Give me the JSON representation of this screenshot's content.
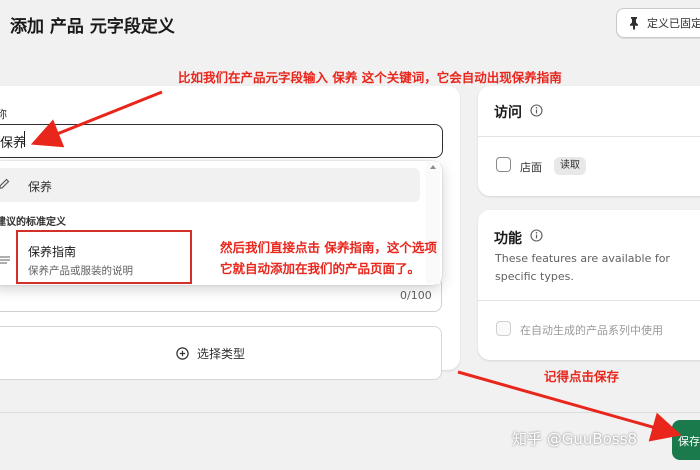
{
  "header": {
    "title": "添加 产品 元字段定义",
    "pin_button_label": "定义已固定"
  },
  "form": {
    "name_label": "称",
    "name_value": "保养",
    "dropdown": {
      "keyword_option": "保养",
      "section_title": "建议的标准定义",
      "suggested_title": "保养指南",
      "suggested_desc": "保养产品或服装的说明"
    },
    "char_counter": "0/100",
    "select_type_label": "选择类型"
  },
  "access": {
    "title": "访问",
    "store_label": "店面",
    "read_badge": "读取"
  },
  "functions": {
    "title": "功能",
    "description": "These features are available for specific types.",
    "auto_collections_label": "在自动生成的产品系列中使用"
  },
  "footer": {
    "save_label": "保存"
  },
  "annotations": {
    "note1": "比如我们在产品元字段输入 保养 这个关键词，它会自动出现保养指南",
    "note2_line1": "然后我们直接点击 保养指南，这个选项",
    "note2_line2": "它就自动添加在我们的产品页面了。",
    "note3": "记得点击保存"
  },
  "watermark": "知乎 @GuuBoss8",
  "colors": {
    "annotation_red": "#e8261c",
    "save_green": "#1a7a4c",
    "background": "#f1f1f1"
  }
}
